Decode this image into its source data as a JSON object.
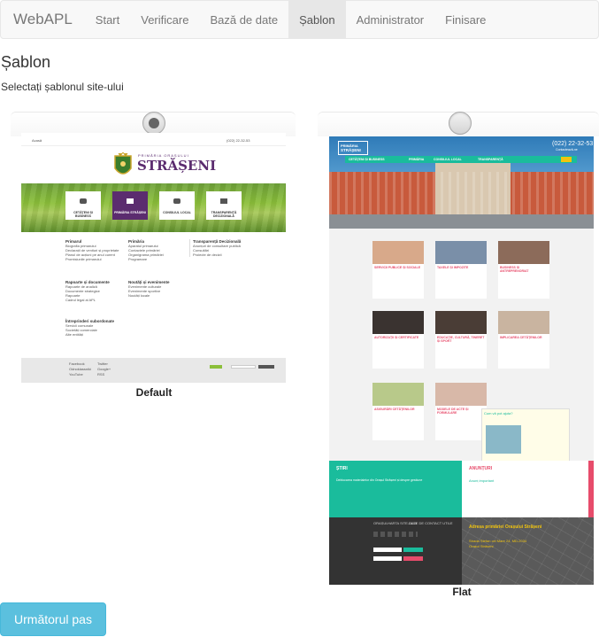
{
  "navbar": {
    "brand": "WebAPL",
    "items": [
      {
        "label": "Start"
      },
      {
        "label": "Verificare"
      },
      {
        "label": "Bază de date"
      },
      {
        "label": "Șablon"
      },
      {
        "label": "Administrator"
      },
      {
        "label": "Finisare"
      }
    ]
  },
  "page": {
    "title": "Șablon",
    "subtitle": "Selectați șablonul site-ului"
  },
  "templates": [
    {
      "label": "Default",
      "selected": true
    },
    {
      "label": "Flat",
      "selected": false
    }
  ],
  "preview_default": {
    "top_left": "Acasă",
    "phone": "(022) 22-32-53",
    "header_line": "PRIMĂRIA ORAȘULUI",
    "header_title": "STRĂȘENI",
    "tiles": [
      "CETĂȚENI ȘI BUSINESS",
      "PRIMĂRIA STRĂȘENI",
      "CONSILIUL LOCAL",
      "TRANSPARENȚĂ DECIZIONALĂ"
    ],
    "col1_title": "Primarul",
    "col1_items": [
      "Biografia primarului",
      "Declarații de venituri și proprietate",
      "Planul de acțiuni pe anul curent",
      "Promisiunile primarului"
    ],
    "col2_title": "Primăria",
    "col2_items": [
      "Aparatul primarului",
      "Contactele primăriei",
      "Organigrama primăriei",
      "Programare"
    ],
    "col3_title": "Transparență Decizională",
    "col3_items": [
      "Anunțuri de consultare publică",
      "Consultări",
      "Proiecte de decizii"
    ],
    "col4_title": "Rapoarte și documente",
    "col4_items": [
      "Rapoarte de analiză",
      "Documente strategice",
      "Rapoarte",
      "Cadrul legal al APL"
    ],
    "col5_title": "Noutăți și evenimente",
    "col5_items": [
      "Evenimente culturale",
      "Evenimente sportive",
      "Noutăți locale"
    ],
    "col6_title": "Întreprinderi subordonate",
    "col6_items": [
      "Servicii comunale",
      "Societăți comerciale",
      "Alte entități"
    ],
    "footer_items": [
      "Facebook",
      "Odnoklassniki",
      "YouTube",
      "Twitter",
      "Google+",
      "RSS"
    ]
  },
  "preview_flat": {
    "logo_line1": "PRIMĂRIA",
    "logo_line2": "STRĂȘENI",
    "phone": "(022) 22-32-53",
    "phone_sub": "Contactează-ne",
    "menu": [
      "CETĂȚENI ȘI BUSINESS",
      "PRIMĂRIA",
      "CONSILIUL LOCAL",
      "TRANSPARENȚĂ"
    ],
    "cards": [
      "SERVICII PUBLICE ȘI SOCIALE",
      "TAXELE ȘI IMPOZITE",
      "BUSINESS ȘI ANTREPRENORIAT",
      "AUTORIZAȚII ȘI CERTIFICATE",
      "EDUCAȚIE, CULTURĂ, TINERET ȘI SPORT",
      "IMPLICAREA CETĂȚENILOR",
      "ASIGURĂRI CETĂȚENILOR",
      "MODELE DE ACTE ȘI FORMULARE"
    ],
    "news_title": "ȘTIRI",
    "news_item": "Deblocarea materialelor din Orașul Strășeni și despre gestiune",
    "ann_title": "ANUNȚURI",
    "ann_item": "Anunț important",
    "ask_title": "Cum vă pot ajuta?",
    "map_title": "Adresa primăriei Orașului Strășeni",
    "map_address": "Strada Ștefan cel Mare 24, MD-2034",
    "map_city": "Orașul Strășeni",
    "footer_links": [
      "ORAȘUL",
      "HARTA SITE-ULUI",
      "DATE DE CONTACT UTILE"
    ]
  },
  "next_button": "Următorul pas",
  "colors": {
    "accent": "#5bc0de",
    "flat_teal": "#1abc9c",
    "flat_pink": "#e74c6b",
    "default_purple": "#5b2c6f",
    "default_green": "#8bbf3a"
  }
}
